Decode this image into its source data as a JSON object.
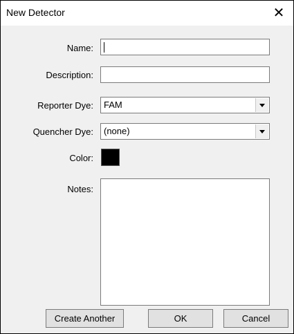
{
  "window": {
    "title": "New Detector",
    "close_glyph": "✕"
  },
  "form": {
    "name_label": "Name:",
    "name_value": "",
    "description_label": "Description:",
    "description_value": "",
    "reporter_label": "Reporter Dye:",
    "reporter_value": "FAM",
    "quencher_label": "Quencher Dye:",
    "quencher_value": "(none)",
    "color_label": "Color:",
    "color_value": "#000000",
    "notes_label": "Notes:",
    "notes_value": ""
  },
  "buttons": {
    "create_another": "Create Another",
    "ok": "OK",
    "cancel": "Cancel"
  }
}
